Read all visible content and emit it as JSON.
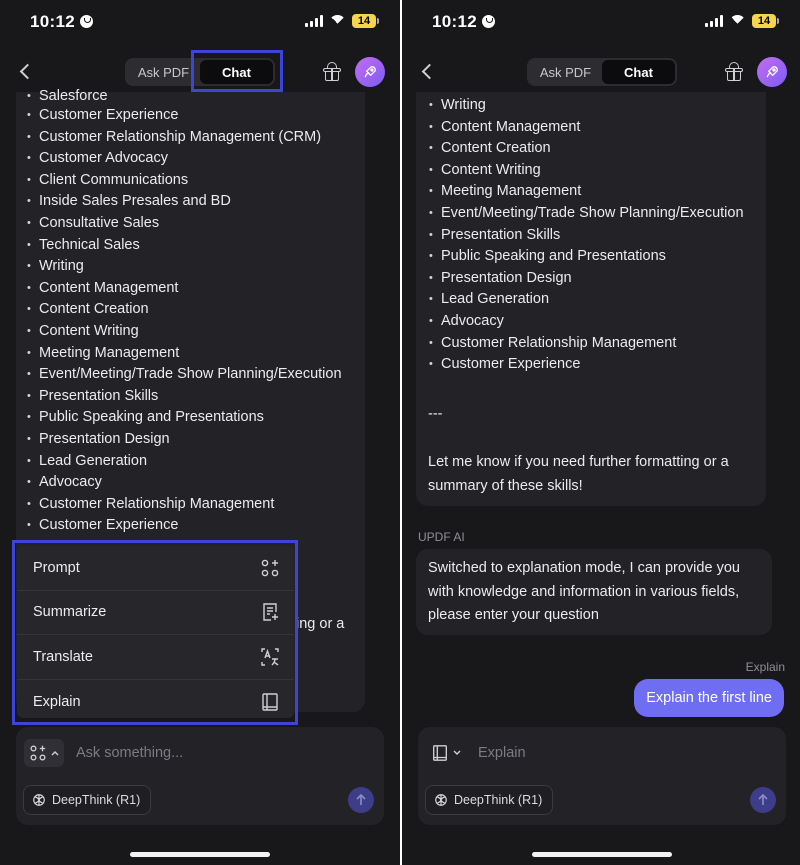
{
  "status_bar": {
    "time": "10:12",
    "battery": "14"
  },
  "nav": {
    "tabs": [
      "Ask PDF",
      "Chat"
    ],
    "active_tab": "Chat"
  },
  "left": {
    "skills": [
      "Salesforce",
      "Customer Experience",
      "Customer Relationship Management (CRM)",
      "Customer Advocacy",
      "Client Communications",
      "Inside Sales Presales and BD",
      "Consultative Sales",
      "Technical Sales",
      "Writing",
      "Content Management",
      "Content Creation",
      "Content Writing",
      "Meeting Management",
      "Event/Meeting/Trade Show Planning/Execution",
      "Presentation Skills",
      "Public Speaking and Presentations",
      "Presentation Design",
      "Lead Generation",
      "Advocacy",
      "Customer Relationship Management",
      "Customer Experience"
    ],
    "hidden_text_fragment": "ing or a",
    "menu": [
      {
        "label": "Prompt",
        "icon": "prompt-grid-icon"
      },
      {
        "label": "Summarize",
        "icon": "summarize-doc-icon"
      },
      {
        "label": "Translate",
        "icon": "translate-icon"
      },
      {
        "label": "Explain",
        "icon": "book-icon"
      }
    ],
    "input_placeholder": "Ask something...",
    "deepthink_label": "DeepThink (R1)"
  },
  "right": {
    "skills": [
      "Writing",
      "Content Management",
      "Content Creation",
      "Content Writing",
      "Meeting Management",
      "Event/Meeting/Trade Show Planning/Execution",
      "Presentation Skills",
      "Public Speaking and Presentations",
      "Presentation Design",
      "Lead Generation",
      "Advocacy",
      "Customer Relationship Management",
      "Customer Experience"
    ],
    "separator": "---",
    "closing_message": "Let me know if you need further formatting or a summary of these skills!",
    "ai_label": "UPDF AI",
    "ai_message": "Switched to explanation mode, I can provide you with knowledge and information in various fields, please enter your question",
    "mode_label": "Explain",
    "user_message": "Explain the first line",
    "input_placeholder": "Explain",
    "deepthink_label": "DeepThink (R1)"
  },
  "colors": {
    "accent": "#6f6ef2",
    "highlight": "#3d45d8",
    "background": "#18181b"
  }
}
